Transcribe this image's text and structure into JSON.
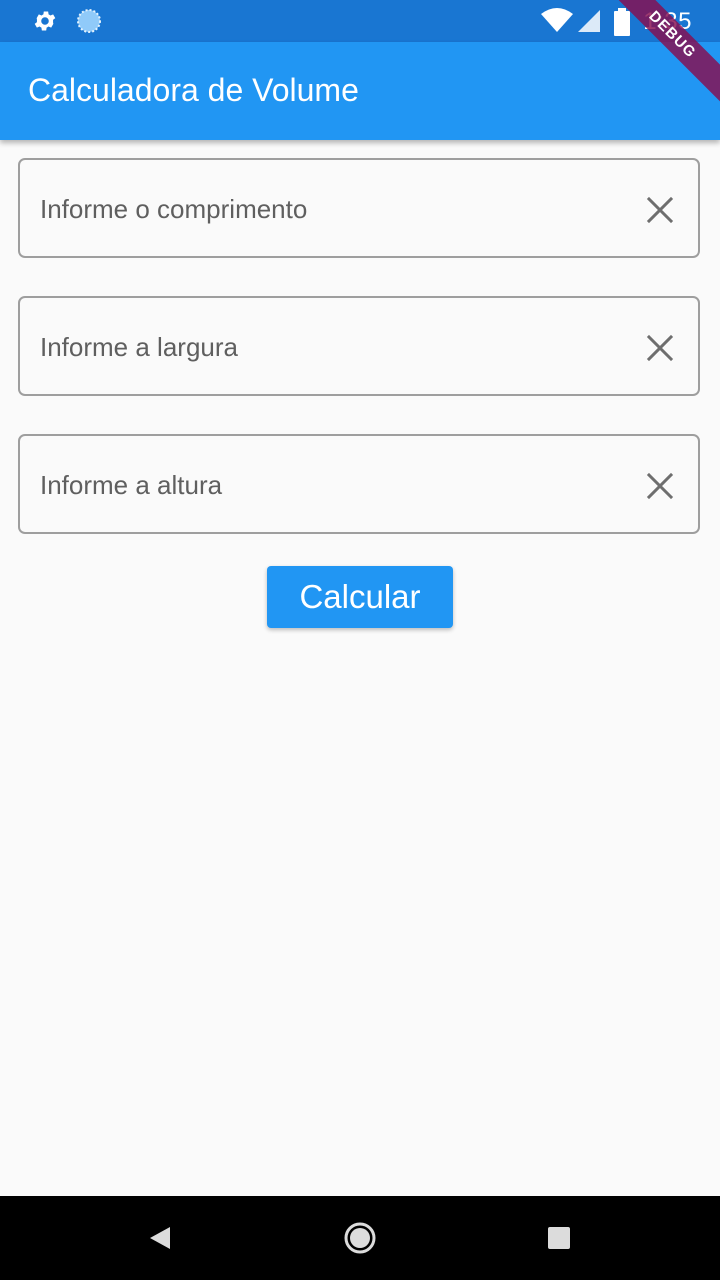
{
  "status_bar": {
    "time": "1:35",
    "icons": [
      "settings-gear-icon",
      "sync-circle-icon",
      "wifi-icon",
      "signal-icon",
      "battery-icon"
    ]
  },
  "app_bar": {
    "title": "Calculadora de Volume",
    "color": "#2196f3"
  },
  "debug_banner": {
    "label": "DEBUG",
    "color": "#880e4f"
  },
  "form": {
    "fields": [
      {
        "label": "Informe o comprimento",
        "value": ""
      },
      {
        "label": "Informe a largura",
        "value": ""
      },
      {
        "label": "Informe a altura",
        "value": ""
      }
    ],
    "clear_icon": "close-icon",
    "submit_label": "Calcular"
  },
  "nav_bar": {
    "icons": [
      "back-triangle-icon",
      "home-circle-icon",
      "recents-square-icon"
    ]
  }
}
